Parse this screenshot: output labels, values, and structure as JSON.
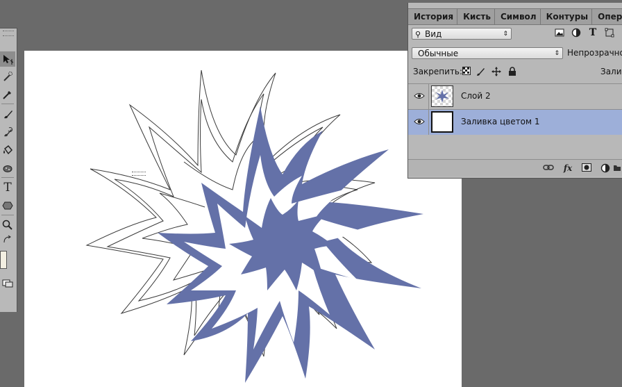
{
  "panel": {
    "tabs": [
      "История",
      "Кисть",
      "Символ",
      "Контуры",
      "Операции"
    ],
    "filter": {
      "label": "Вид"
    },
    "blend_mode": "Обычные",
    "opacity_label": "Непрозрачно",
    "lock_label": "Закрепить:",
    "fill_label": "Залив"
  },
  "layers": [
    {
      "name": "Слой 2",
      "selected": false
    },
    {
      "name": "Заливка цветом 1",
      "selected": true
    }
  ],
  "colors": {
    "shape_fill": "#6471a8",
    "selection": "#9dafd9",
    "panel_bg": "#b8b8b8",
    "workspace_bg": "#6a6a6a",
    "canvas_bg": "#ffffff"
  },
  "icons": {
    "tools": [
      "move-icon",
      "quick-select-icon",
      "eyedropper-icon",
      "brush-icon",
      "history-brush-icon",
      "paint-bucket-icon",
      "sponge-icon",
      "type-icon",
      "shape-icon",
      "zoom-icon",
      "swap-colors-icon",
      "screen-mode-icon"
    ],
    "layer_filters": [
      "image-filter-icon",
      "adjustment-filter-icon",
      "type-filter-icon",
      "shape-filter-icon"
    ],
    "locks": [
      "lock-pixels-icon",
      "lock-brush-icon",
      "lock-position-icon",
      "lock-all-icon"
    ],
    "bottom": [
      "link-icon",
      "fx-icon",
      "mask-icon",
      "adjustment-icon"
    ]
  }
}
